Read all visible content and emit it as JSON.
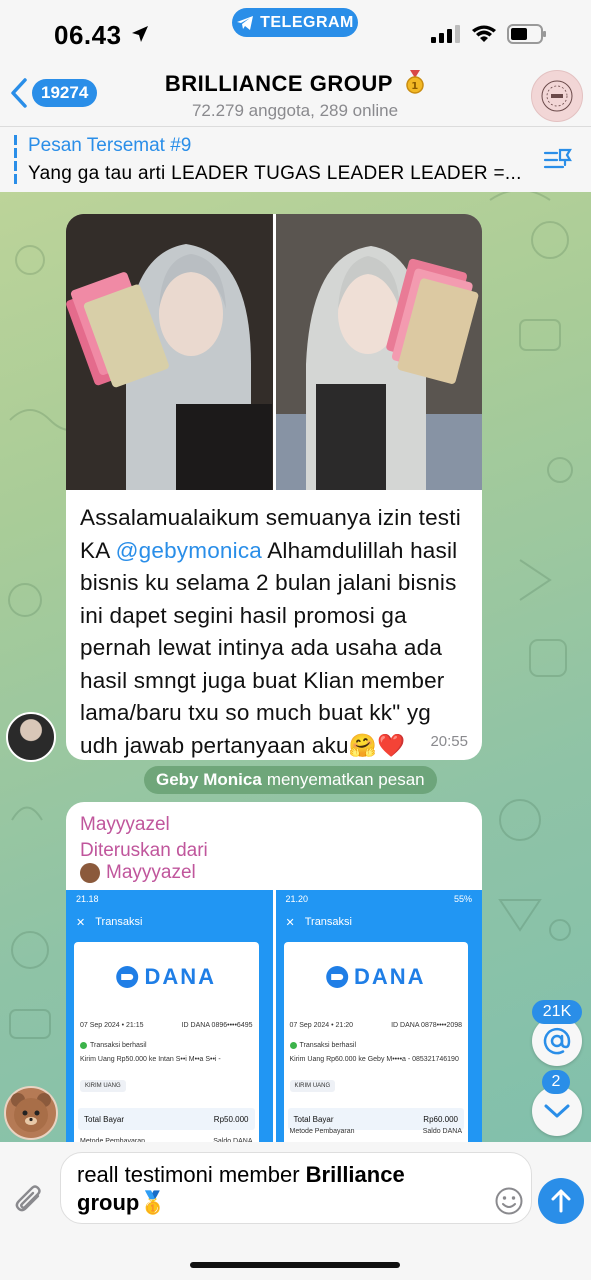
{
  "status_bar": {
    "time": "06.43",
    "app_pill": "TELEGRAM"
  },
  "header": {
    "back_count": "19274",
    "title": "BRILLIANCE GROUP",
    "subtitle": "72.279 anggota, 289 online"
  },
  "pinned": {
    "title": "Pesan Tersemat #9",
    "text": "Yang ga tau arti LEADER TUGAS LEADER LEADER =..."
  },
  "message1": {
    "text_before_mention": "Assalamualaikum semuanya izin testi KA ",
    "mention": "@gebymonica",
    "text_after_mention": " Alhamdulillah hasil bisnis ku selama 2 bulan jalani bisnis ini dapet segini hasil promosi ga pernah lewat intinya ada usaha ada hasil smngt juga buat Klian member lama/baru txu so much buat kk\" yg udh jawab pertanyaan aku",
    "emojis": "🤗❤️",
    "time": "20:55"
  },
  "service_message": {
    "actor": "Geby Monica",
    "action": " menyematkan pesan"
  },
  "message2": {
    "sender": "Mayyyazel",
    "forwarded_label": "Diteruskan dari",
    "forwarded_from": "Mayyyazel",
    "screenshots": [
      {
        "clock": "21.18",
        "nav_title": "Transaksi",
        "logo": "DANA",
        "date": "07 Sep 2024 • 21:15",
        "dana_id": "ID DANA 0896••••6495",
        "status": "Transaksi berhasil",
        "desc": "Kirim Uang Rp50.000 ke Intan S••i M••a S••i -",
        "tag": "KIRIM UANG",
        "total_label": "Total Bayar",
        "total_value": "Rp50.000",
        "method_label": "Metode Pembayaran",
        "method_value": "Saldo DANA"
      },
      {
        "clock": "21.20",
        "nav_title": "Transaksi",
        "logo": "DANA",
        "date": "07 Sep 2024 • 21:20",
        "dana_id": "ID DANA 0878••••2098",
        "status": "Transaksi berhasil",
        "desc": "Kirim Uang Rp60.000 ke Geby M••••a - 085321746190",
        "tag": "KIRIM UANG",
        "total_label": "Total Bayar",
        "total_value": "Rp60.000",
        "method_label": "Metode Pembayaran",
        "method_value": "Saldo DANA",
        "battery": "55%"
      }
    ]
  },
  "floating": {
    "mentions_count": "21K",
    "unread_count": "2"
  },
  "composer": {
    "text_plain": "reall testimoni member ",
    "text_bold_1": "Brilliance",
    "text_bold_2": "group",
    "medal": "🥇"
  },
  "icons": [
    "location-arrow-icon",
    "telegram-icon",
    "signal-icon",
    "wifi-icon",
    "battery-icon",
    "back-chevron-icon",
    "medal-icon",
    "pin-list-icon",
    "attach-icon",
    "emoji-icon",
    "send-icon",
    "at-icon",
    "chevron-down-icon"
  ],
  "colors": {
    "accent": "#2a8ee8",
    "forward_name": "#c0569c",
    "service_bg": "#508c5a"
  }
}
